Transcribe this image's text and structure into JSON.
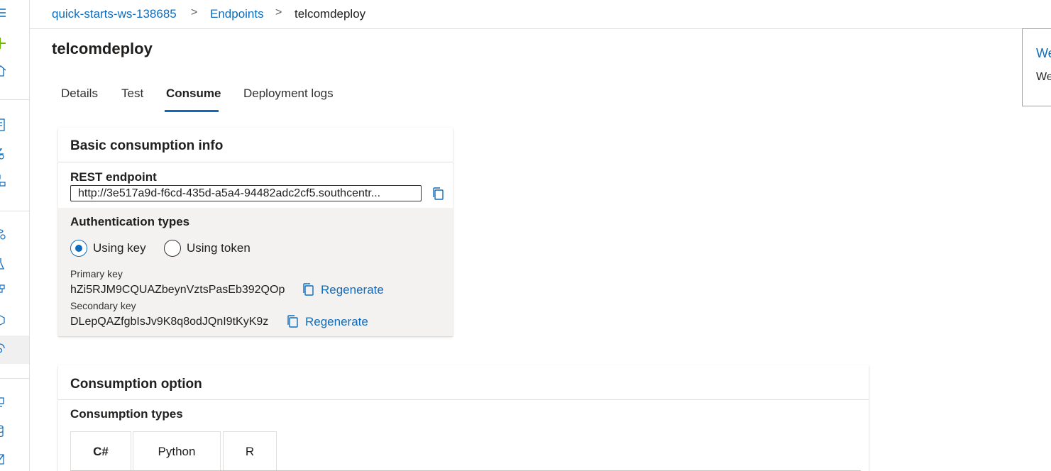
{
  "breadcrumb": {
    "items": [
      "quick-starts-ws-138685",
      "Endpoints",
      "telcomdeploy"
    ],
    "separator": ">"
  },
  "page": {
    "title": "telcomdeploy"
  },
  "tabs": [
    {
      "label": "Details",
      "active": false
    },
    {
      "label": "Test",
      "active": false
    },
    {
      "label": "Consume",
      "active": true
    },
    {
      "label": "Deployment logs",
      "active": false
    }
  ],
  "basic_info": {
    "title": "Basic consumption info",
    "rest_endpoint_label": "REST endpoint",
    "rest_endpoint_value": "http://3e517a9d-f6cd-435d-a5a4-94482adc2cf5.southcentr...",
    "auth_types_label": "Authentication types",
    "auth_options": [
      {
        "label": "Using key",
        "selected": true
      },
      {
        "label": "Using token",
        "selected": false
      }
    ],
    "primary_key_label": "Primary key",
    "primary_key_value": "hZi5RJM9CQUAZbeynVztsPasEb392QOp",
    "secondary_key_label": "Secondary key",
    "secondary_key_value": "DLepQAZfgbIsJv9K8q8odJQnI9tKyK9z",
    "regenerate_label": "Regenerate"
  },
  "consumption_option": {
    "title": "Consumption option",
    "types_label": "Consumption types",
    "types": [
      {
        "label": "C#",
        "active": true
      },
      {
        "label": "Python",
        "active": false
      },
      {
        "label": "R",
        "active": false
      }
    ]
  },
  "side_panel": {
    "title": "We",
    "text": "We"
  },
  "colors": {
    "accent": "#0f6cbd",
    "text": "#201f1e",
    "border": "#e1dfdd",
    "auth_bg": "#f3f2f1"
  },
  "rail_icons": [
    "hamburger-icon",
    "plus-icon",
    "home-icon",
    "notebook-icon",
    "automl-icon",
    "designer-icon",
    "datasets-icon",
    "experiments-icon",
    "pipelines-icon",
    "models-icon",
    "endpoints-icon",
    "compute-icon",
    "datastores-icon",
    "data-labeling-icon"
  ]
}
